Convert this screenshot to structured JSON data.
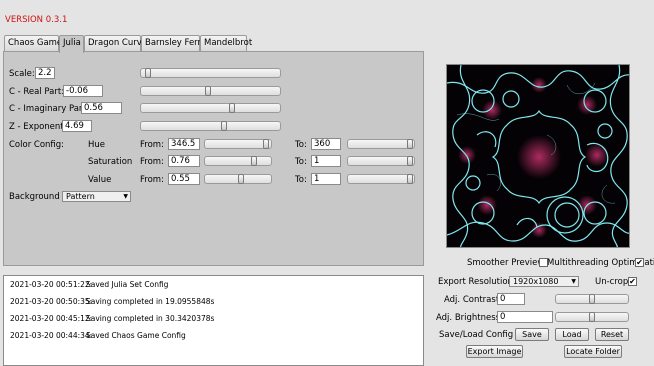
{
  "app": {
    "version": "VERSION 0.3.1"
  },
  "tabs": [
    {
      "label": "Chaos Game"
    },
    {
      "label": "Julia"
    },
    {
      "label": "Dragon Curve"
    },
    {
      "label": "Barnsley Fern"
    },
    {
      "label": "Mandelbrot"
    }
  ],
  "active_tab": "Julia",
  "params": {
    "scale": {
      "label": "Scale:",
      "value": "2.2",
      "slider_level": 0.03
    },
    "real": {
      "label": "C - Real Part:",
      "value": "-0.06",
      "slider_level": 0.48
    },
    "imag": {
      "label": "C - Imaginary Part:",
      "value": "0.56",
      "slider_level": 0.66
    },
    "exp": {
      "label": "Z - Exponent:",
      "value": "4.69",
      "slider_level": 0.6
    }
  },
  "color_config": {
    "label": "Color Config:",
    "from_label": "From:",
    "to_label": "To:",
    "rows": [
      {
        "name": "Hue",
        "from": "346.5",
        "from_level": 0.96,
        "to": "360",
        "to_level": 0.99
      },
      {
        "name": "Saturation",
        "from": "0.76",
        "from_level": 0.76,
        "to": "1",
        "to_level": 0.99
      },
      {
        "name": "Value",
        "from": "0.55",
        "from_level": 0.55,
        "to": "1",
        "to_level": 0.99
      }
    ]
  },
  "background": {
    "label": "Background :",
    "value": "Pattern"
  },
  "log": [
    {
      "time": "2021-03-20 00:51:22:",
      "message": "Saved Julia Set Config"
    },
    {
      "time": "2021-03-20 00:50:35:",
      "message": "Saving completed in 19.0955848s"
    },
    {
      "time": "2021-03-20 00:45:12:",
      "message": "Saving completed in 30.3420378s"
    },
    {
      "time": "2021-03-20 00:44:34:",
      "message": "Saved Chaos Game Config"
    }
  ],
  "options": {
    "smoother_preview": {
      "label": "Smoother Preview",
      "checked": false
    },
    "multithreading": {
      "label": "Multithreading Optimization",
      "checked": true
    }
  },
  "export": {
    "resolution_label": "Export Resolution :",
    "resolution_value": "1920x1080",
    "uncrop_label": "Un-crop",
    "uncrop_checked": true,
    "contrast_label": "Adj. Contrast:",
    "contrast_value": "0",
    "contrast_level": 0.5,
    "brightness_label": "Adj. Brightness:",
    "brightness_value": "0",
    "brightness_level": 0.5,
    "saveload_label": "Save/Load Config :",
    "save_button": "Save",
    "load_button": "Load",
    "reset_button": "Reset",
    "export_image_button": "Export Image",
    "locate_folder_button": "Locate Folder"
  },
  "colors": {
    "version_text": "#d01010",
    "panel_bg": "#c8c8c8",
    "window_bg": "#e4e4e4",
    "fractal_cyan": "#7fe8ee",
    "fractal_magenta": "#c0306a"
  }
}
